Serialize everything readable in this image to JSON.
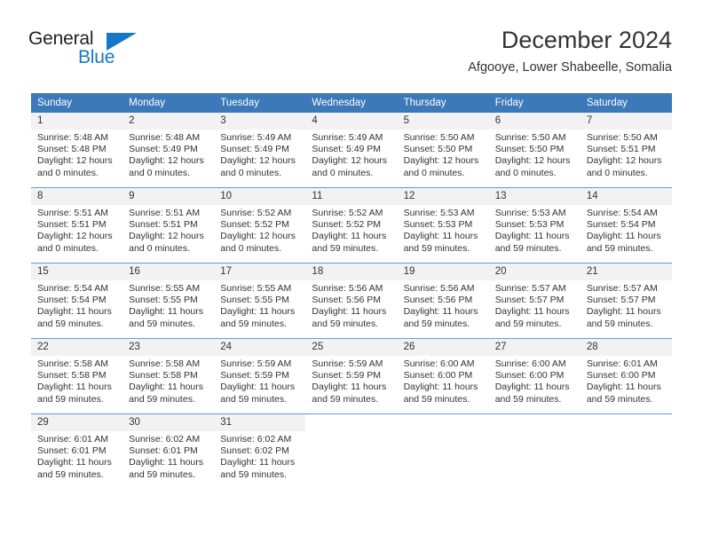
{
  "logo": {
    "primary_text": "General",
    "secondary_text": "Blue",
    "accent_color": "#1676c8"
  },
  "header": {
    "title": "December 2024",
    "subtitle": "Afgooye, Lower Shabeelle, Somalia"
  },
  "theme": {
    "header_background": "#3b79b8",
    "header_text": "#ffffff",
    "daynum_background": "#f2f2f2",
    "row_border": "#6a9bd0",
    "body_text": "#333333"
  },
  "weekday_headers": [
    "Sunday",
    "Monday",
    "Tuesday",
    "Wednesday",
    "Thursday",
    "Friday",
    "Saturday"
  ],
  "weeks": [
    [
      {
        "day": "1",
        "sunrise": "Sunrise: 5:48 AM",
        "sunset": "Sunset: 5:48 PM",
        "daylight_line1": "Daylight: 12 hours",
        "daylight_line2": "and 0 minutes."
      },
      {
        "day": "2",
        "sunrise": "Sunrise: 5:48 AM",
        "sunset": "Sunset: 5:49 PM",
        "daylight_line1": "Daylight: 12 hours",
        "daylight_line2": "and 0 minutes."
      },
      {
        "day": "3",
        "sunrise": "Sunrise: 5:49 AM",
        "sunset": "Sunset: 5:49 PM",
        "daylight_line1": "Daylight: 12 hours",
        "daylight_line2": "and 0 minutes."
      },
      {
        "day": "4",
        "sunrise": "Sunrise: 5:49 AM",
        "sunset": "Sunset: 5:49 PM",
        "daylight_line1": "Daylight: 12 hours",
        "daylight_line2": "and 0 minutes."
      },
      {
        "day": "5",
        "sunrise": "Sunrise: 5:50 AM",
        "sunset": "Sunset: 5:50 PM",
        "daylight_line1": "Daylight: 12 hours",
        "daylight_line2": "and 0 minutes."
      },
      {
        "day": "6",
        "sunrise": "Sunrise: 5:50 AM",
        "sunset": "Sunset: 5:50 PM",
        "daylight_line1": "Daylight: 12 hours",
        "daylight_line2": "and 0 minutes."
      },
      {
        "day": "7",
        "sunrise": "Sunrise: 5:50 AM",
        "sunset": "Sunset: 5:51 PM",
        "daylight_line1": "Daylight: 12 hours",
        "daylight_line2": "and 0 minutes."
      }
    ],
    [
      {
        "day": "8",
        "sunrise": "Sunrise: 5:51 AM",
        "sunset": "Sunset: 5:51 PM",
        "daylight_line1": "Daylight: 12 hours",
        "daylight_line2": "and 0 minutes."
      },
      {
        "day": "9",
        "sunrise": "Sunrise: 5:51 AM",
        "sunset": "Sunset: 5:51 PM",
        "daylight_line1": "Daylight: 12 hours",
        "daylight_line2": "and 0 minutes."
      },
      {
        "day": "10",
        "sunrise": "Sunrise: 5:52 AM",
        "sunset": "Sunset: 5:52 PM",
        "daylight_line1": "Daylight: 12 hours",
        "daylight_line2": "and 0 minutes."
      },
      {
        "day": "11",
        "sunrise": "Sunrise: 5:52 AM",
        "sunset": "Sunset: 5:52 PM",
        "daylight_line1": "Daylight: 11 hours",
        "daylight_line2": "and 59 minutes."
      },
      {
        "day": "12",
        "sunrise": "Sunrise: 5:53 AM",
        "sunset": "Sunset: 5:53 PM",
        "daylight_line1": "Daylight: 11 hours",
        "daylight_line2": "and 59 minutes."
      },
      {
        "day": "13",
        "sunrise": "Sunrise: 5:53 AM",
        "sunset": "Sunset: 5:53 PM",
        "daylight_line1": "Daylight: 11 hours",
        "daylight_line2": "and 59 minutes."
      },
      {
        "day": "14",
        "sunrise": "Sunrise: 5:54 AM",
        "sunset": "Sunset: 5:54 PM",
        "daylight_line1": "Daylight: 11 hours",
        "daylight_line2": "and 59 minutes."
      }
    ],
    [
      {
        "day": "15",
        "sunrise": "Sunrise: 5:54 AM",
        "sunset": "Sunset: 5:54 PM",
        "daylight_line1": "Daylight: 11 hours",
        "daylight_line2": "and 59 minutes."
      },
      {
        "day": "16",
        "sunrise": "Sunrise: 5:55 AM",
        "sunset": "Sunset: 5:55 PM",
        "daylight_line1": "Daylight: 11 hours",
        "daylight_line2": "and 59 minutes."
      },
      {
        "day": "17",
        "sunrise": "Sunrise: 5:55 AM",
        "sunset": "Sunset: 5:55 PM",
        "daylight_line1": "Daylight: 11 hours",
        "daylight_line2": "and 59 minutes."
      },
      {
        "day": "18",
        "sunrise": "Sunrise: 5:56 AM",
        "sunset": "Sunset: 5:56 PM",
        "daylight_line1": "Daylight: 11 hours",
        "daylight_line2": "and 59 minutes."
      },
      {
        "day": "19",
        "sunrise": "Sunrise: 5:56 AM",
        "sunset": "Sunset: 5:56 PM",
        "daylight_line1": "Daylight: 11 hours",
        "daylight_line2": "and 59 minutes."
      },
      {
        "day": "20",
        "sunrise": "Sunrise: 5:57 AM",
        "sunset": "Sunset: 5:57 PM",
        "daylight_line1": "Daylight: 11 hours",
        "daylight_line2": "and 59 minutes."
      },
      {
        "day": "21",
        "sunrise": "Sunrise: 5:57 AM",
        "sunset": "Sunset: 5:57 PM",
        "daylight_line1": "Daylight: 11 hours",
        "daylight_line2": "and 59 minutes."
      }
    ],
    [
      {
        "day": "22",
        "sunrise": "Sunrise: 5:58 AM",
        "sunset": "Sunset: 5:58 PM",
        "daylight_line1": "Daylight: 11 hours",
        "daylight_line2": "and 59 minutes."
      },
      {
        "day": "23",
        "sunrise": "Sunrise: 5:58 AM",
        "sunset": "Sunset: 5:58 PM",
        "daylight_line1": "Daylight: 11 hours",
        "daylight_line2": "and 59 minutes."
      },
      {
        "day": "24",
        "sunrise": "Sunrise: 5:59 AM",
        "sunset": "Sunset: 5:59 PM",
        "daylight_line1": "Daylight: 11 hours",
        "daylight_line2": "and 59 minutes."
      },
      {
        "day": "25",
        "sunrise": "Sunrise: 5:59 AM",
        "sunset": "Sunset: 5:59 PM",
        "daylight_line1": "Daylight: 11 hours",
        "daylight_line2": "and 59 minutes."
      },
      {
        "day": "26",
        "sunrise": "Sunrise: 6:00 AM",
        "sunset": "Sunset: 6:00 PM",
        "daylight_line1": "Daylight: 11 hours",
        "daylight_line2": "and 59 minutes."
      },
      {
        "day": "27",
        "sunrise": "Sunrise: 6:00 AM",
        "sunset": "Sunset: 6:00 PM",
        "daylight_line1": "Daylight: 11 hours",
        "daylight_line2": "and 59 minutes."
      },
      {
        "day": "28",
        "sunrise": "Sunrise: 6:01 AM",
        "sunset": "Sunset: 6:00 PM",
        "daylight_line1": "Daylight: 11 hours",
        "daylight_line2": "and 59 minutes."
      }
    ],
    [
      {
        "day": "29",
        "sunrise": "Sunrise: 6:01 AM",
        "sunset": "Sunset: 6:01 PM",
        "daylight_line1": "Daylight: 11 hours",
        "daylight_line2": "and 59 minutes."
      },
      {
        "day": "30",
        "sunrise": "Sunrise: 6:02 AM",
        "sunset": "Sunset: 6:01 PM",
        "daylight_line1": "Daylight: 11 hours",
        "daylight_line2": "and 59 minutes."
      },
      {
        "day": "31",
        "sunrise": "Sunrise: 6:02 AM",
        "sunset": "Sunset: 6:02 PM",
        "daylight_line1": "Daylight: 11 hours",
        "daylight_line2": "and 59 minutes."
      },
      {
        "day": "",
        "sunrise": "",
        "sunset": "",
        "daylight_line1": "",
        "daylight_line2": ""
      },
      {
        "day": "",
        "sunrise": "",
        "sunset": "",
        "daylight_line1": "",
        "daylight_line2": ""
      },
      {
        "day": "",
        "sunrise": "",
        "sunset": "",
        "daylight_line1": "",
        "daylight_line2": ""
      },
      {
        "day": "",
        "sunrise": "",
        "sunset": "",
        "daylight_line1": "",
        "daylight_line2": ""
      }
    ]
  ]
}
